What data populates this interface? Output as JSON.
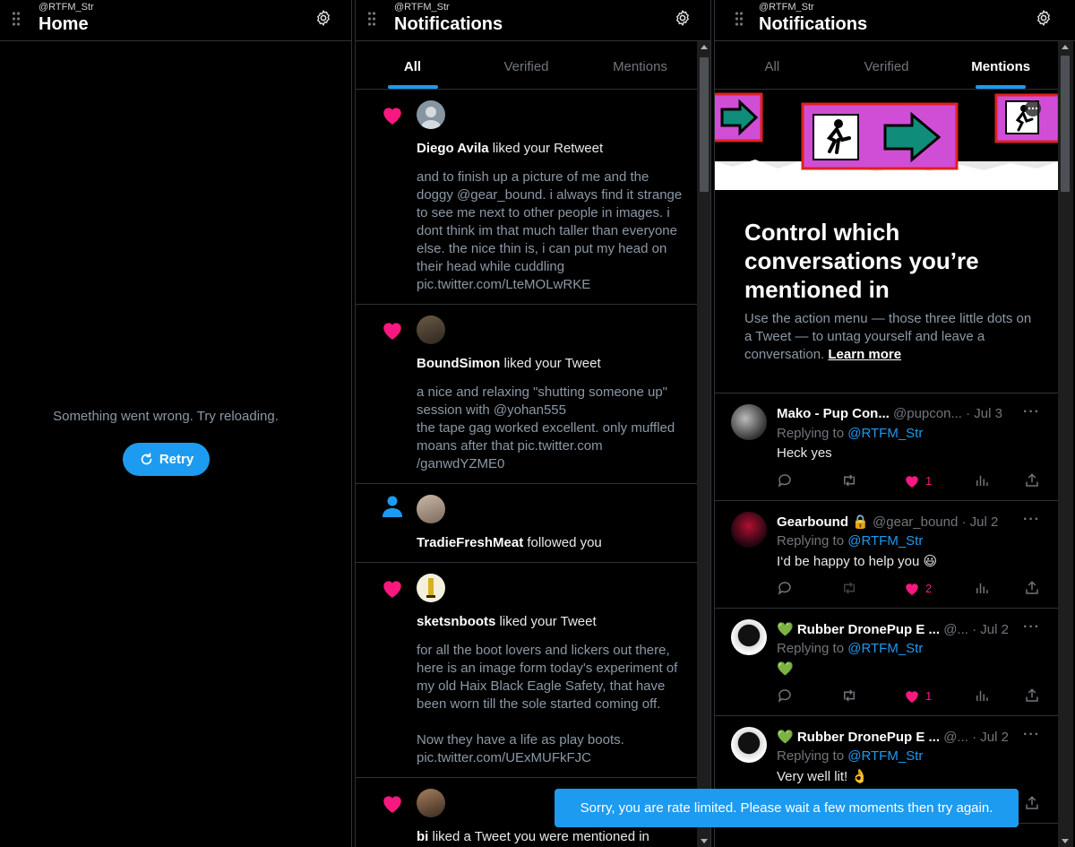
{
  "columns": {
    "home": {
      "handle": "@RTFM_Str",
      "title": "Home",
      "error_message": "Something went wrong. Try reloading.",
      "retry_label": "Retry"
    },
    "notifications": {
      "handle": "@RTFM_Str",
      "title": "Notifications",
      "tabs": [
        "All",
        "Verified",
        "Mentions"
      ],
      "active_tab": "All",
      "items": [
        {
          "type": "like",
          "user": "Diego Avila",
          "action": " liked your Retweet",
          "text": "and to finish up a picture of me and the doggy @gear_bound. i always find it strange to see me next to other people in images. i dont think im that much taller than everyone else. the nice thin is, i can put my head on their head while cuddling pic.twitter.com/LteMOLwRKE"
        },
        {
          "type": "like",
          "user": "BoundSimon",
          "action": " liked your Tweet",
          "text": "a nice and relaxing \"shutting someone up\" session with @yohan555\nthe tape gag worked excellent. only muffled moans after that pic.twitter.com\n/ganwdYZME0"
        },
        {
          "type": "follow",
          "user": "TradieFreshMeat",
          "action": " followed you",
          "text": ""
        },
        {
          "type": "like",
          "user": "sketsnboots",
          "action": " liked your Tweet",
          "text": "for all the boot lovers and lickers out there, here is an image form today's experiment of my old Haix Black Eagle Safety, that have been worn till the sole started coming off.\n\nNow they have a life as play boots.\npic.twitter.com/UExMUFkFJC"
        },
        {
          "type": "like",
          "user": "bi",
          "action": " liked a Tweet you were mentioned in",
          "text": ""
        }
      ]
    },
    "mentions": {
      "handle": "@RTFM_Str",
      "title": "Notifications",
      "tabs": [
        "All",
        "Verified",
        "Mentions"
      ],
      "active_tab": "Mentions",
      "promo_title": "Control which conversations you’re mentioned in",
      "promo_text": "Use the action menu — those three little dots on a Tweet — to untag yourself and leave a conversation.",
      "promo_link": "Learn more",
      "tweets": [
        {
          "name": "Mako - Pup Con...",
          "handle": "@pupcon...",
          "date": "· Jul 3",
          "replying_prefix": "Replying to ",
          "replying_to": "@RTFM_Str",
          "text": "Heck yes",
          "likes": "1"
        },
        {
          "name": "Gearbound 🔒",
          "handle": "@gear_bound",
          "date": "· Jul 2",
          "replying_prefix": "Replying to ",
          "replying_to": "@RTFM_Str",
          "text": "I‘d be happy to help you 😃",
          "likes": "2"
        },
        {
          "name": "💚 Rubber DronePup E ...",
          "handle": "@...",
          "date": "· Jul 2",
          "replying_prefix": "Replying to ",
          "replying_to": "@RTFM_Str",
          "text": "💚",
          "likes": "1"
        },
        {
          "name": "💚 Rubber DronePup E ...",
          "handle": "@...",
          "date": "· Jul 2",
          "replying_prefix": "Replying to ",
          "replying_to": "@RTFM_Str",
          "text": "Very well lit! 👌",
          "likes": ""
        }
      ]
    }
  },
  "toast": "Sorry, you are rate limited. Please wait a few moments then try again.",
  "colors": {
    "accent": "#1d9bf0",
    "like": "#f91880",
    "background": "#000000",
    "border": "#2f3336",
    "muted": "#71767b"
  }
}
